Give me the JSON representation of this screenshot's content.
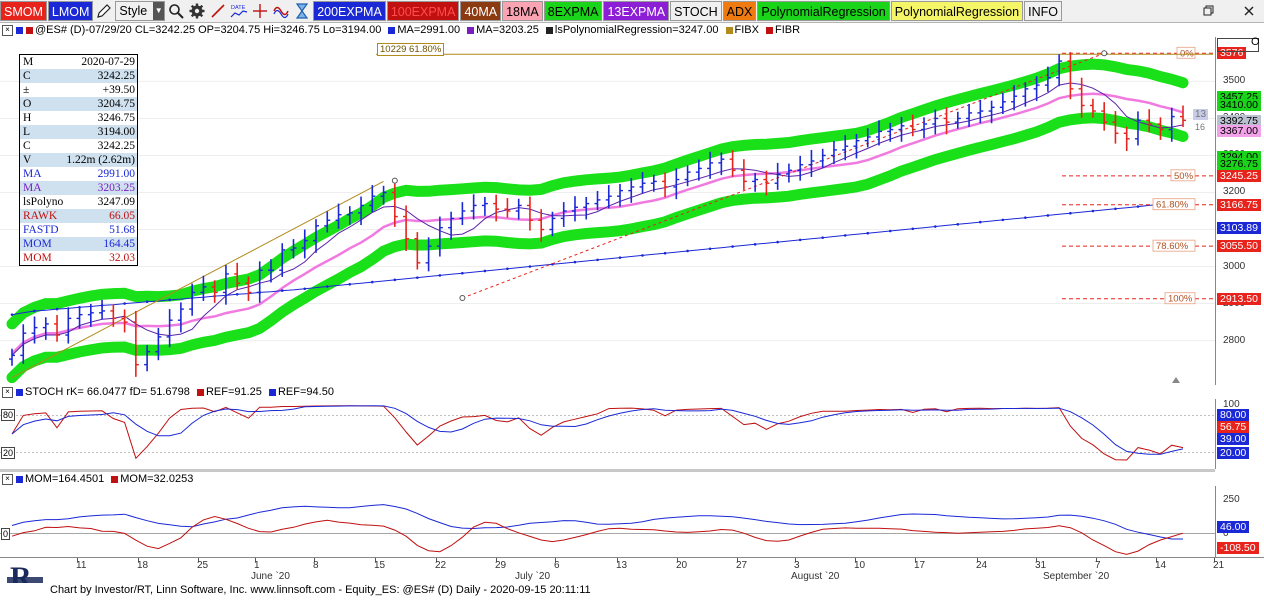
{
  "toolbar": {
    "buttons": [
      {
        "label": "SMOM",
        "bg": "#e8231c",
        "fg": "#ffffff"
      },
      {
        "label": "LMOM",
        "bg": "#1a28d6",
        "fg": "#ffffff"
      },
      {
        "label": "Style",
        "bg": "#f0f0f0",
        "fg": "#000000"
      },
      {
        "label": "200EXPMA",
        "bg": "#1a28d6",
        "fg": "#ffffff"
      },
      {
        "label": "100EXPMA",
        "bg": "#c01010",
        "fg": "#ff4c4c"
      },
      {
        "label": "40MA",
        "bg": "#8b3a12",
        "fg": "#ffffff"
      },
      {
        "label": "18MA",
        "bg": "#f9a3b3",
        "fg": "#000000"
      },
      {
        "label": "8EXPMA",
        "bg": "#19d419",
        "fg": "#000000"
      },
      {
        "label": "13EXPMA",
        "bg": "#8c1ed6",
        "fg": "#ffffff"
      },
      {
        "label": "STOCH",
        "bg": "#f0f0f0",
        "fg": "#000000"
      },
      {
        "label": "ADX",
        "bg": "#ef7a10",
        "fg": "#000000"
      },
      {
        "label": "PolynomialRegression",
        "bg": "#19d419",
        "fg": "#000000"
      },
      {
        "label": "PolynomialRegression",
        "bg": "#f5f568",
        "fg": "#000000"
      },
      {
        "label": "INFO",
        "bg": "#f0f0f0",
        "fg": "#000000"
      }
    ],
    "icons": [
      "pencil-icon",
      "magnifier-icon",
      "gear-icon",
      "trendline-icon",
      "date-icon",
      "crosshair-icon",
      "wave-icon",
      "hourglass-icon"
    ]
  },
  "header": {
    "main": {
      "symbol": "@ES# (D)-07/29/20 CL=3242.25 OP=3204.75 Hi=3246.75 Lo=3194.00",
      "items": [
        "MA=2991.00",
        "MA=3203.25",
        "lsPolynomialRegression=3247.00",
        "FIBX",
        "FIBR"
      ]
    },
    "stoch": {
      "text": "STOCH rK= 66.0477 fD= 51.6798",
      "ref1": "REF=91.25",
      "ref2": "REF=94.50"
    },
    "mom": {
      "text1": "MOM=164.4501",
      "text2": "MOM=32.0253"
    }
  },
  "fib_label": "10229 61.80%",
  "data_window": [
    {
      "k": "M",
      "v": "2020-07-29",
      "c": "#000000",
      "hl": false
    },
    {
      "k": "C",
      "v": "3242.25",
      "c": "#000000",
      "hl": true
    },
    {
      "k": "±",
      "v": "+39.50",
      "c": "#000000",
      "hl": false
    },
    {
      "k": "O",
      "v": "3204.75",
      "c": "#000000",
      "hl": true
    },
    {
      "k": "H",
      "v": "3246.75",
      "c": "#000000",
      "hl": false
    },
    {
      "k": "L",
      "v": "3194.00",
      "c": "#000000",
      "hl": true
    },
    {
      "k": "C",
      "v": "3242.25",
      "c": "#000000",
      "hl": false
    },
    {
      "k": "V",
      "v": "1.22m (2.62m)",
      "c": "#000000",
      "hl": true
    },
    {
      "k": "MA",
      "v": "2991.00",
      "c": "#1a28d6",
      "hl": false
    },
    {
      "k": "MA",
      "v": "3203.25",
      "c": "#7a1ec0",
      "hl": true
    },
    {
      "k": "lsPolyno",
      "v": "3247.09",
      "c": "#000000",
      "hl": false
    },
    {
      "k": "RAWK",
      "v": "66.05",
      "c": "#c01010",
      "hl": true
    },
    {
      "k": "FASTD",
      "v": "51.68",
      "c": "#1a28d6",
      "hl": false
    },
    {
      "k": "MOM",
      "v": "164.45",
      "c": "#1a28d6",
      "hl": true
    },
    {
      "k": "MOM",
      "v": "32.03",
      "c": "#c01010",
      "hl": false
    }
  ],
  "price_axis": {
    "ticks": [
      "3500",
      "3400",
      "3300",
      "3200",
      "3100",
      "3000",
      "2900",
      "2800"
    ],
    "labels": [
      {
        "text": "3576",
        "price": 3576,
        "bg": "#e8231c",
        "fg": "#ffffff"
      },
      {
        "text": "3457.25",
        "price": 3457,
        "bg": "#19d419",
        "fg": "#000000"
      },
      {
        "text": "3410.00",
        "price": 3435,
        "bg": "#19d419",
        "fg": "#000000"
      },
      {
        "text": "3392.75",
        "price": 3393,
        "bg": "#b9c0cf",
        "fg": "#000000"
      },
      {
        "text": "3367.00",
        "price": 3367,
        "bg": "#f2a0e8",
        "fg": "#000000"
      },
      {
        "text": "3294.00",
        "price": 3296,
        "bg": "#19d419",
        "fg": "#000000"
      },
      {
        "text": "3276.75",
        "price": 3276,
        "bg": "#19d419",
        "fg": "#000000"
      },
      {
        "text": "3245.25",
        "price": 3245,
        "bg": "#e8231c",
        "fg": "#ffffff"
      },
      {
        "text": "3166.75",
        "price": 3167,
        "bg": "#e8231c",
        "fg": "#ffffff"
      },
      {
        "text": "3103.89",
        "price": 3104,
        "bg": "#1a28d6",
        "fg": "#ffffff"
      },
      {
        "text": "3055.50",
        "price": 3055,
        "bg": "#e8231c",
        "fg": "#ffffff"
      },
      {
        "text": "2913.50",
        "price": 2913,
        "bg": "#e8231c",
        "fg": "#ffffff"
      }
    ],
    "small_tags": [
      "13",
      "16"
    ]
  },
  "fib_levels": [
    {
      "pct": "0%",
      "price": 3576
    },
    {
      "pct": "50%",
      "price": 3245
    },
    {
      "pct": "61.80%",
      "price": 3167
    },
    {
      "pct": "78.60%",
      "price": 3055
    },
    {
      "pct": "100%",
      "price": 2913
    }
  ],
  "stoch_axis": {
    "ticks": [
      "100",
      "80",
      "20"
    ],
    "left_ticks": [
      "80",
      "20"
    ],
    "labels": [
      {
        "text": "80.00",
        "value": 80,
        "bg": "#1a28d6",
        "fg": "#ffffff"
      },
      {
        "text": "56.75",
        "value": 62,
        "bg": "#e8231c",
        "fg": "#ffffff"
      },
      {
        "text": "39.00",
        "value": 42,
        "bg": "#1a28d6",
        "fg": "#ffffff"
      },
      {
        "text": "20.00",
        "value": 20,
        "bg": "#1a28d6",
        "fg": "#ffffff"
      }
    ]
  },
  "mom_axis": {
    "ticks": [
      "250",
      "0"
    ],
    "left_ticks": [
      "0"
    ],
    "labels": [
      {
        "text": "46.00",
        "value": 46,
        "bg": "#1a28d6",
        "fg": "#ffffff"
      },
      {
        "text": "-108.50",
        "value": -108,
        "bg": "#e8231c",
        "fg": "#ffffff"
      }
    ]
  },
  "x_axis": {
    "days": [
      "11",
      "18",
      "25",
      "1",
      "8",
      "15",
      "22",
      "29",
      "6",
      "13",
      "20",
      "27",
      "3",
      "10",
      "17",
      "24",
      "31",
      "7",
      "14",
      "21"
    ],
    "months": [
      "June `20",
      "July `20",
      "August `20",
      "September `20"
    ]
  },
  "footer": "Chart by Investor/RT, Linn Software, Inc. www.linnsoft.com - Equity_ES: @ES# (D) Daily - 2020-09-15 20:11:11",
  "chart_data": [
    {
      "type": "bar",
      "title": "@ES# (D) Daily",
      "ylim": [
        2680,
        3620
      ],
      "series": [
        {
          "name": "Close",
          "values": [
            2760,
            2820,
            2835,
            2845,
            2815,
            2860,
            2870,
            2875,
            2880,
            2860,
            2850,
            2735,
            2770,
            2810,
            2855,
            2885,
            2930,
            2945,
            2930,
            2980,
            2955,
            2930,
            2990,
            2990,
            3045,
            3050,
            3070,
            3110,
            3125,
            3140,
            3145,
            3165,
            3190,
            3200,
            3135,
            3075,
            3010,
            3055,
            3105,
            3130,
            3150,
            3165,
            3170,
            3155,
            3150,
            3165,
            3125,
            3100,
            3130,
            3150,
            3160,
            3170,
            3180,
            3190,
            3205,
            3215,
            3225,
            3230,
            3215,
            3235,
            3255,
            3265,
            3280,
            3290,
            3260,
            3230,
            3235,
            3225,
            3250,
            3260,
            3275,
            3285,
            3300,
            3315,
            3325,
            3340,
            3350,
            3365,
            3370,
            3380,
            3370,
            3385,
            3400,
            3390,
            3400,
            3415,
            3420,
            3430,
            3445,
            3460,
            3480,
            3490,
            3510,
            3555,
            3480,
            3435,
            3420,
            3390,
            3360,
            3345,
            3395,
            3385,
            3370,
            3405,
            3395
          ]
        },
        {
          "name": "MA",
          "values": [
            2870,
            2875,
            2880,
            2882,
            2885,
            2887,
            2890,
            2892,
            2895,
            2897,
            2900,
            2902,
            2905,
            2907,
            2910,
            2912,
            2915,
            2917,
            2920,
            2922,
            2925,
            2927,
            2930,
            2932,
            2935,
            2937,
            2940,
            2943,
            2946,
            2949,
            2952,
            2955,
            2958,
            2961,
            2964,
            2967,
            2970,
            2973,
            2976,
            2979,
            2982,
            2985,
            2988,
            2991,
            2994,
            2997,
            3000,
            3003,
            3006,
            3009,
            3012,
            3015,
            3018,
            3021,
            3024,
            3027,
            3030,
            3033,
            3036,
            3039,
            3042,
            3045,
            3048,
            3051,
            3054,
            3057,
            3060,
            3063,
            3066,
            3069,
            3072,
            3075,
            3078,
            3081,
            3084,
            3087,
            3090,
            3093,
            3096,
            3099,
            3102,
            3105,
            3108,
            3111,
            3114,
            3117,
            3120,
            3123,
            3126,
            3129,
            3132,
            3135,
            3138,
            3141,
            3144,
            3147,
            3150,
            3153,
            3156,
            3159,
            3162,
            3165,
            3168,
            3171,
            3174
          ]
        }
      ]
    }
  ]
}
